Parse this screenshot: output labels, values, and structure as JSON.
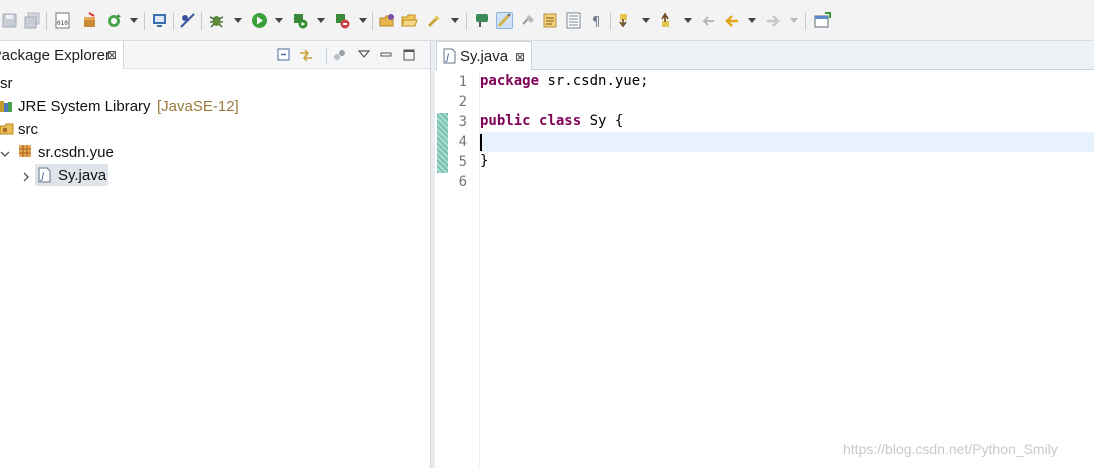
{
  "toolbar": {
    "icons": [
      "save-icon",
      "save-all-icon",
      "binary-icon",
      "new-package-icon",
      "refresh-icon",
      "display-icon",
      "skip-breakpoints-icon",
      "debug-icon",
      "run-icon",
      "coverage-icon",
      "external-tools-icon",
      "open-type-icon",
      "open-folder-icon",
      "search-icon",
      "annotation-icon",
      "highlight-icon",
      "last-edit-icon",
      "toggle-mark-icon",
      "block-selection-icon",
      "show-whitespace-icon",
      "next-annotation-icon",
      "previous-annotation-icon",
      "back-edit-icon",
      "back-icon",
      "forward-icon",
      "perspective-icon"
    ]
  },
  "package_explorer": {
    "title": "Package Explorer",
    "tree": [
      {
        "label": "sr",
        "decoration": ""
      },
      {
        "label": "JRE System Library",
        "decoration": "[JavaSE-12]"
      },
      {
        "label": "src",
        "decoration": ""
      },
      {
        "label": "sr.csdn.yue",
        "decoration": ""
      },
      {
        "label": "Sy.java",
        "decoration": ""
      }
    ]
  },
  "editor": {
    "tab_label": "Sy.java",
    "line_numbers": [
      "1",
      "2",
      "3",
      "4",
      "5",
      "6"
    ],
    "lines": [
      {
        "kw": "package",
        "rest": " sr.csdn.yue;"
      },
      {
        "kw": "",
        "rest": ""
      },
      {
        "kw": "public",
        "kw2": "class",
        "rest": " Sy {"
      },
      {
        "kw": "",
        "rest": ""
      },
      {
        "kw": "",
        "rest": "}"
      },
      {
        "kw": "",
        "rest": ""
      }
    ],
    "current_line": 4
  },
  "watermark": "https://blog.csdn.net/Python_Smily",
  "colors": {
    "keyword": "#7f0055",
    "current_line": "#e8f2fe",
    "change_bar": "#8fcfc0"
  }
}
